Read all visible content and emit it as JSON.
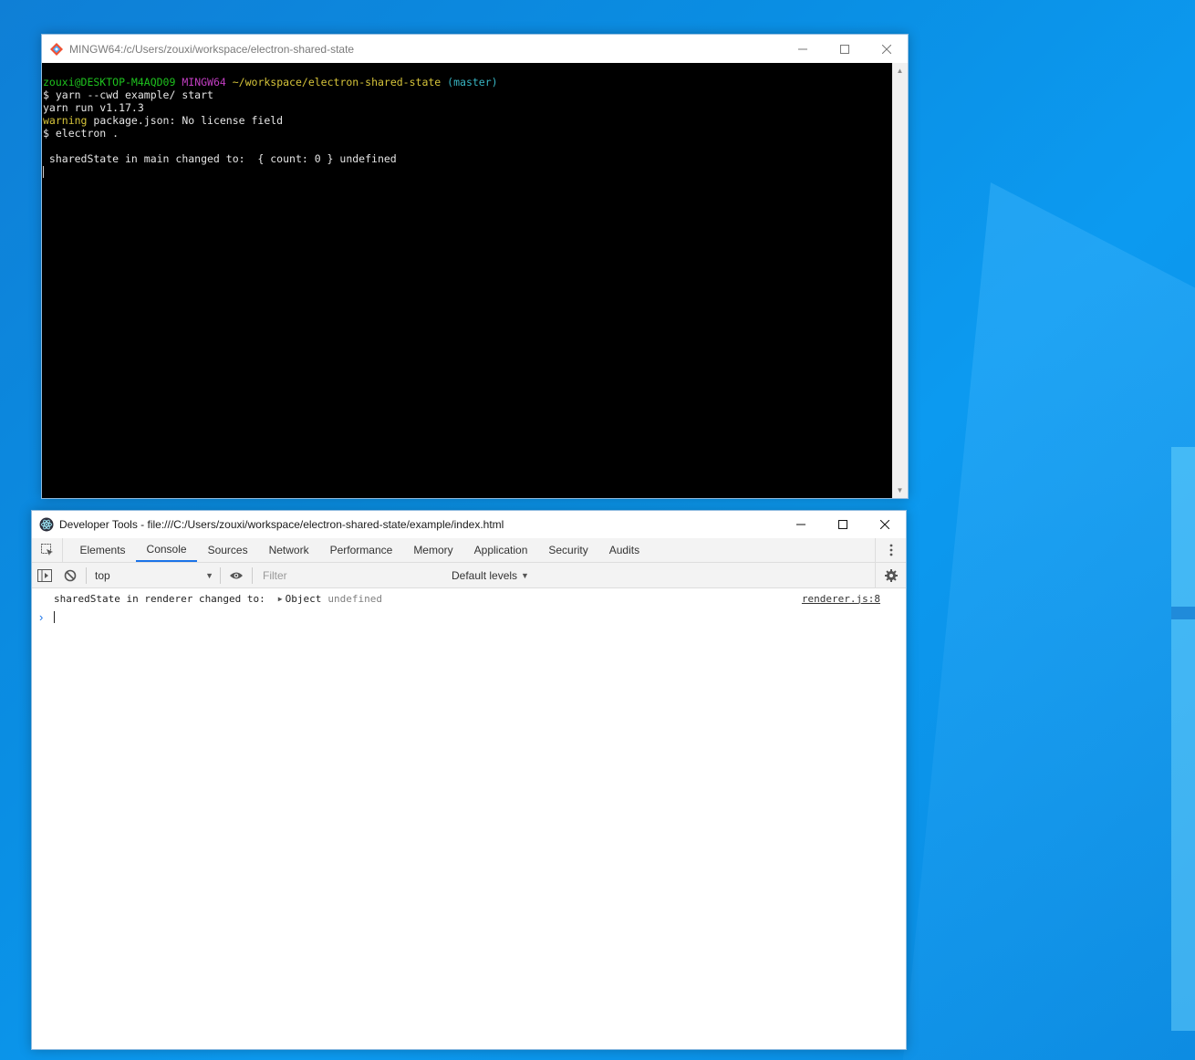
{
  "terminal": {
    "title": "MINGW64:/c/Users/zouxi/workspace/electron-shared-state",
    "lines": {
      "prompt_user": "zouxi@DESKTOP-M4AQD09",
      "prompt_env": "MINGW64",
      "prompt_path": "~/workspace/electron-shared-state",
      "prompt_branch": "(master)",
      "cmd1": "$ yarn --cwd example/ start",
      "out1": "yarn run v1.17.3",
      "warn_label": "warning",
      "warn_text": " package.json: No license field",
      "cmd2": "$ electron .",
      "out2": " sharedState in main changed to:  { count: 0 } undefined"
    }
  },
  "devtools": {
    "title": "Developer Tools - file:///C:/Users/zouxi/workspace/electron-shared-state/example/index.html",
    "tabs": [
      {
        "label": "Elements"
      },
      {
        "label": "Console"
      },
      {
        "label": "Sources"
      },
      {
        "label": "Network"
      },
      {
        "label": "Performance"
      },
      {
        "label": "Memory"
      },
      {
        "label": "Application"
      },
      {
        "label": "Security"
      },
      {
        "label": "Audits"
      }
    ],
    "active_tab": "Console",
    "toolbar": {
      "context": "top",
      "filter_placeholder": "Filter",
      "levels": "Default levels"
    },
    "console": {
      "message": "sharedState in renderer changed to:",
      "object_label": "Object",
      "undefined_label": "undefined",
      "source": "renderer.js:8"
    }
  },
  "colors": {
    "accent": "#1a73e8",
    "terminal_bg": "#000000",
    "desktop_bg": "#0a8ee3"
  }
}
